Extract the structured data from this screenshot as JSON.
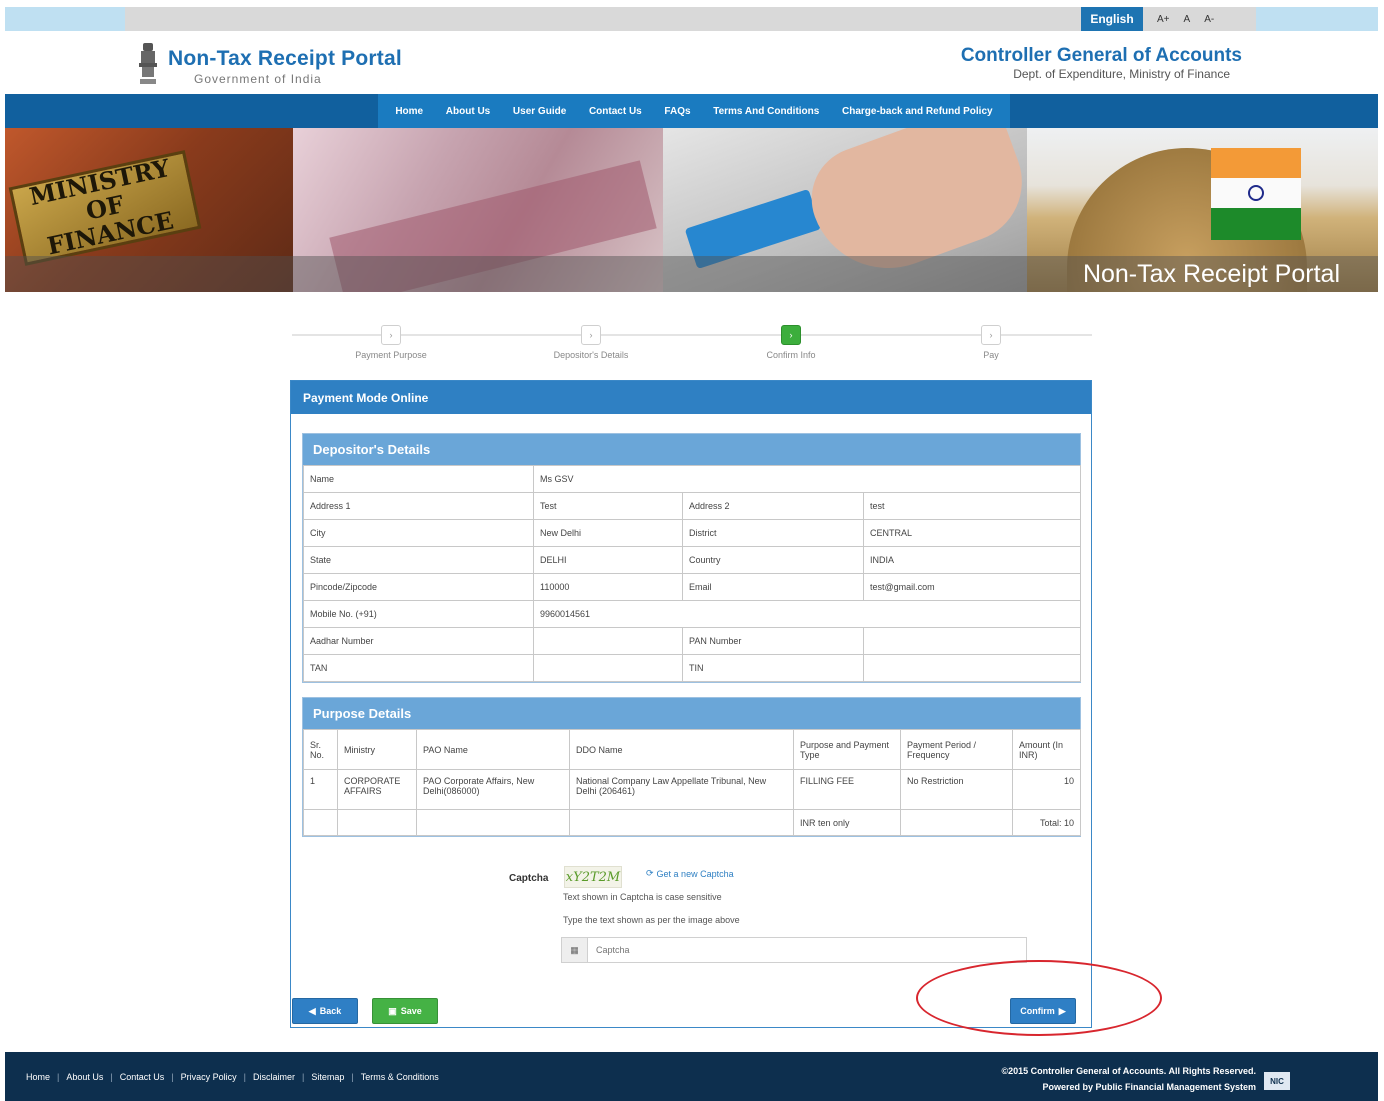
{
  "topbar": {
    "language": "English",
    "font_controls": [
      "A+",
      "A",
      "A-"
    ]
  },
  "header": {
    "brand_title": "Non-Tax Receipt Portal",
    "brand_subtitle": "Government of India",
    "org_title": "Controller General of Accounts",
    "org_subtitle": "Dept. of Expenditure, Ministry of Finance"
  },
  "nav": {
    "items": [
      "Home",
      "About Us",
      "User Guide",
      "Contact Us",
      "FAQs",
      "Terms And Conditions",
      "Charge-back and Refund Policy"
    ]
  },
  "banner": {
    "title": "Non-Tax Receipt Portal",
    "sign_text": "MINISTRY OF FINANCE"
  },
  "steps": [
    {
      "label": "Payment Purpose",
      "active": false
    },
    {
      "label": "Depositor's Details",
      "active": false
    },
    {
      "label": "Confirm Info",
      "active": true
    },
    {
      "label": "Pay",
      "active": false
    }
  ],
  "panel": {
    "title": "Payment Mode Online"
  },
  "depositor": {
    "title": "Depositor's Details",
    "name_label": "Name",
    "name_value": "Ms GSV",
    "address1_label": "Address 1",
    "address1_value": "Test",
    "address2_label": "Address 2",
    "address2_value": "test",
    "city_label": "City",
    "city_value": "New Delhi",
    "district_label": "District",
    "district_value": "CENTRAL",
    "state_label": "State",
    "state_value": "DELHI",
    "country_label": "Country",
    "country_value": "INDIA",
    "pincode_label": "Pincode/Zipcode",
    "pincode_value": "110000",
    "email_label": "Email",
    "email_value": "test@gmail.com",
    "mobile_label": "Mobile No. (+91)",
    "mobile_value": "9960014561",
    "aadhar_label": "Aadhar Number",
    "aadhar_value": "",
    "pan_label": "PAN Number",
    "pan_value": "",
    "tan_label": "TAN",
    "tan_value": "",
    "tin_label": "TIN",
    "tin_value": ""
  },
  "purpose": {
    "title": "Purpose Details",
    "headers": [
      "Sr. No.",
      "Ministry",
      "PAO Name",
      "DDO Name",
      "Purpose and Payment Type",
      "Payment Period / Frequency",
      "Amount (In INR)"
    ],
    "rows": [
      [
        "1",
        "CORPORATE AFFAIRS",
        "PAO Corporate Affairs, New Delhi(086000)",
        "National Company Law Appellate Tribunal, New Delhi (206461)",
        "FILLING FEE",
        "No Restriction",
        "10"
      ]
    ],
    "words_label": "INR ten only",
    "total_label": "Total: 10"
  },
  "captcha": {
    "label": "Captcha",
    "image_text": "xY2T2M",
    "refresh_label": "Get a new Captcha",
    "note": "Text shown in Captcha is case sensitive",
    "help": "Type the text shown as per the image above",
    "placeholder": "Captcha"
  },
  "buttons": {
    "back": "Back",
    "save": "Save",
    "confirm": "Confirm"
  },
  "footer": {
    "links": [
      "Home",
      "About Us",
      "Contact Us",
      "Privacy Policy",
      "Disclaimer",
      "Sitemap",
      "Terms & Conditions"
    ],
    "copyright": "©2015 Controller General of Accounts. All Rights Reserved.",
    "powered": "Powered by   Public Financial Management System",
    "nic": "NIC"
  },
  "colors": {
    "primary": "#2f80c3",
    "nav": "#11609e",
    "success": "#45b245",
    "footer": "#0d2f4e",
    "highlight": "#d8262e"
  }
}
